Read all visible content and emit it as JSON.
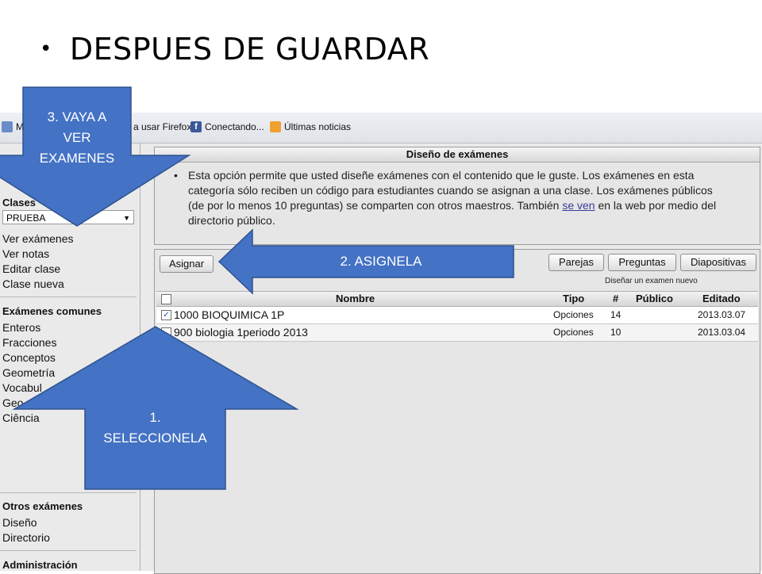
{
  "slide": {
    "bullet": "•",
    "title": "DESPUES DE GUARDAR"
  },
  "bookmarks": [
    {
      "label": "M",
      "icon": "globe-icon"
    },
    {
      "label": "a usar Firefox",
      "icon": ""
    },
    {
      "label": "Conectando...",
      "icon": "facebook-icon"
    },
    {
      "label": "Últimas noticias",
      "icon": "rss-icon"
    }
  ],
  "sidebar": {
    "classes_heading": "Clases",
    "class_select_value": "PRUEBA",
    "class_links": [
      "Ver exámenes",
      "Ver notas",
      "Editar clase",
      "Clase nueva"
    ],
    "common_heading": "Exámenes comunes",
    "common_links": [
      "Enteros",
      "Fracciones",
      "Conceptos",
      "Geometría",
      "Vocabul",
      "Geo",
      "Ciência"
    ],
    "other_heading": "Otros exámenes",
    "other_links": [
      "Diseño",
      "Directorio"
    ],
    "admin_heading": "Administración"
  },
  "design_panel": {
    "title": "Diseño de exámenes",
    "bullet": "•",
    "intro_text": "Esta opción permite que usted diseñe exámenes con el contenido que le guste. Los exámenes en esta categoría sólo reciben un código para estudiantes cuando se asignan a una clase. Los exámenes públicos (de por lo menos 10 preguntas) se comparten con otros maestros. También ",
    "intro_link": "se ven",
    "intro_tail": " en la web por medio del directorio público."
  },
  "toolbar": {
    "assign": "Asignar",
    "pairs": "Parejas",
    "questions": "Preguntas",
    "slides": "Diapositivas",
    "design_new_hint": "Diseñar un examen nuevo"
  },
  "table": {
    "headers": {
      "name": "Nombre",
      "type": "Tipo",
      "count": "#",
      "public": "Público",
      "edited": "Editado"
    },
    "rows": [
      {
        "checked": true,
        "name": "1000 BIOQUIMICA 1P",
        "type": "Opciones",
        "count": "14",
        "public": "",
        "edited": "2013.03.07"
      },
      {
        "checked": false,
        "name": "900 biologia 1periodo 2013",
        "type": "Opciones",
        "count": "10",
        "public": "",
        "edited": "2013.03.04"
      }
    ]
  },
  "callouts": {
    "step1": [
      "1.",
      "SELECCIONELA"
    ],
    "step2": "2. ASIGNELA",
    "step3": [
      "3. VAYA A",
      "VER",
      "EXAMENES"
    ],
    "fill_color": "#4472c4",
    "stroke_color": "#2f528f"
  }
}
